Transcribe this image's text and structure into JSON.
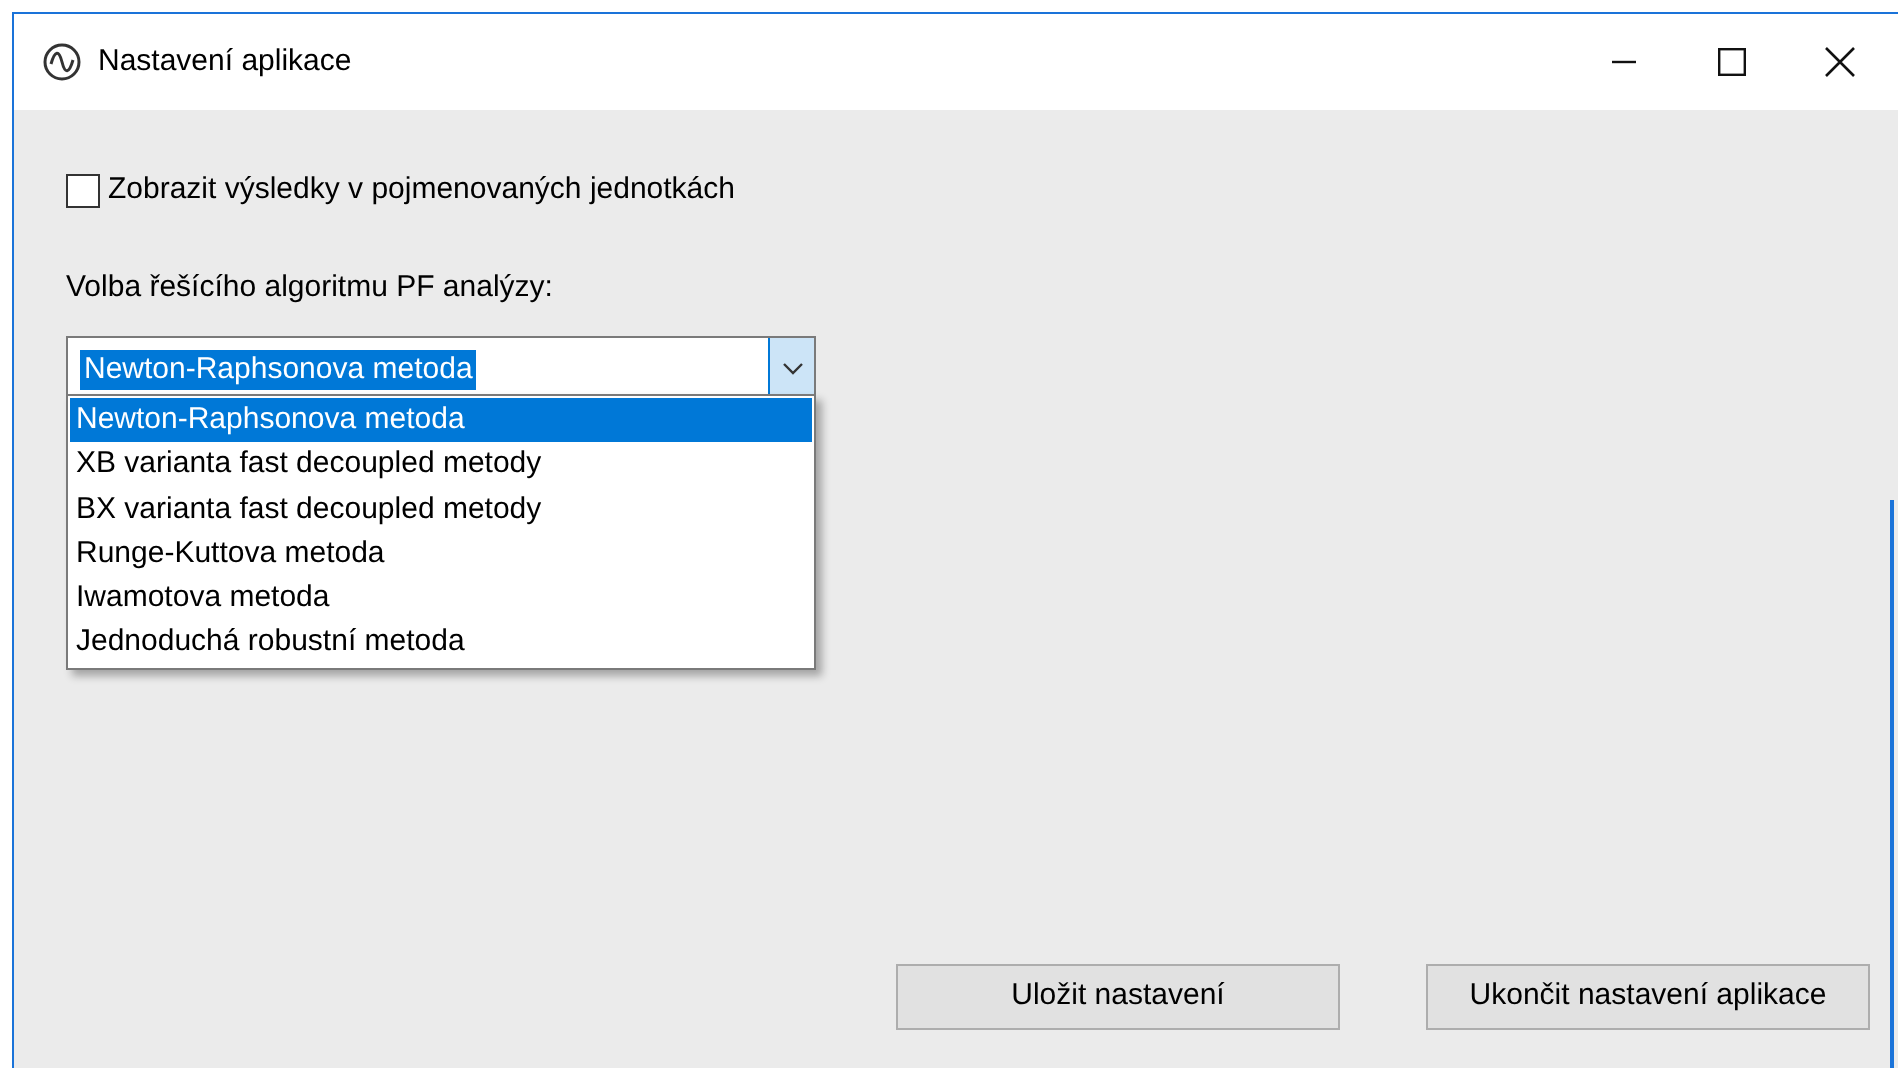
{
  "window": {
    "title": "Nastavení aplikace"
  },
  "checkbox": {
    "label": "Zobrazit výsledky v pojmenovaných jednotkách",
    "checked": false
  },
  "algorithm_label": "Volba řešícího algoritmu PF analýzy:",
  "combo": {
    "value": "Newton-Raphsonova metoda",
    "expanded": true,
    "options": [
      {
        "label": "Newton-Raphsonova metoda",
        "selected": true
      },
      {
        "label": "XB varianta fast decoupled metody",
        "selected": false
      },
      {
        "label": "BX varianta fast decoupled metody",
        "selected": false
      },
      {
        "label": "Runge-Kuttova metoda",
        "selected": false
      },
      {
        "label": "Iwamotova metoda",
        "selected": false
      },
      {
        "label": "Jednoduchá robustní metoda",
        "selected": false
      }
    ]
  },
  "buttons": [
    {
      "label": "Uložit nastavení"
    },
    {
      "label": "Ukončit nastavení aplikace"
    }
  ]
}
